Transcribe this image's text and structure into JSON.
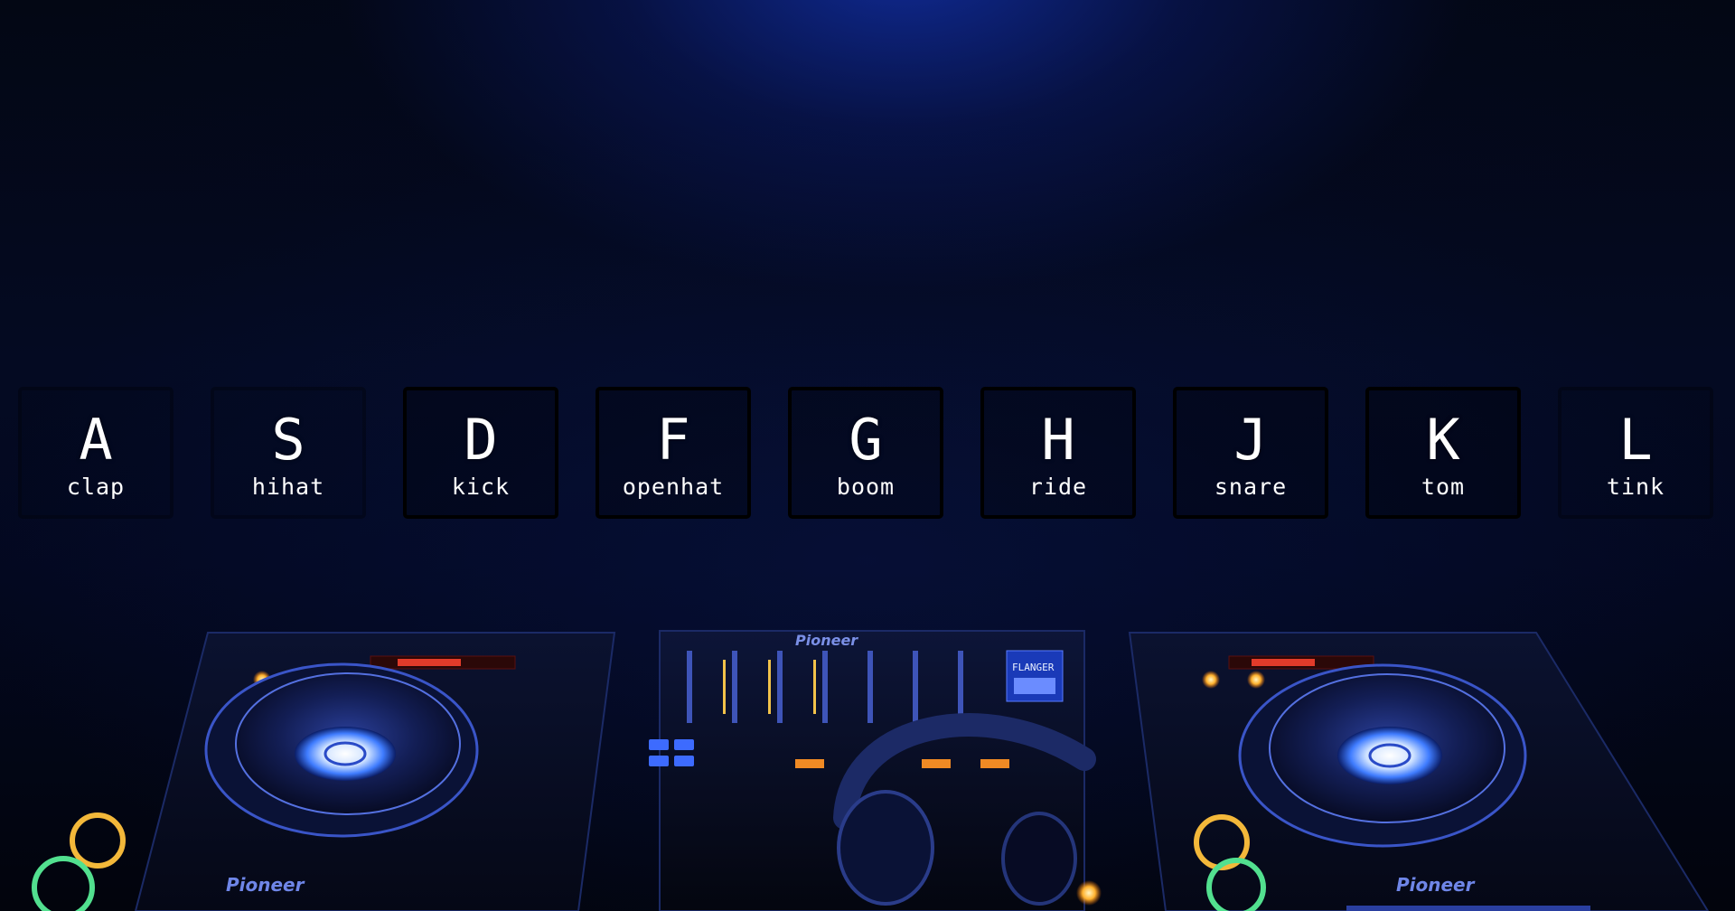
{
  "keys": [
    {
      "letter": "A",
      "sound": "clap"
    },
    {
      "letter": "S",
      "sound": "hihat"
    },
    {
      "letter": "D",
      "sound": "kick"
    },
    {
      "letter": "F",
      "sound": "openhat"
    },
    {
      "letter": "G",
      "sound": "boom"
    },
    {
      "letter": "H",
      "sound": "ride"
    },
    {
      "letter": "J",
      "sound": "snare"
    },
    {
      "letter": "K",
      "sound": "tom"
    },
    {
      "letter": "L",
      "sound": "tink"
    }
  ],
  "equipment": {
    "left_deck_brand": "Pioneer",
    "right_deck_brand": "Pioneer",
    "mixer_brand": "Pioneer",
    "mixer_display": "FLANGER"
  },
  "colors": {
    "glow": "#1230aa",
    "key_text": "#ffffff",
    "key_border": "#000000"
  }
}
